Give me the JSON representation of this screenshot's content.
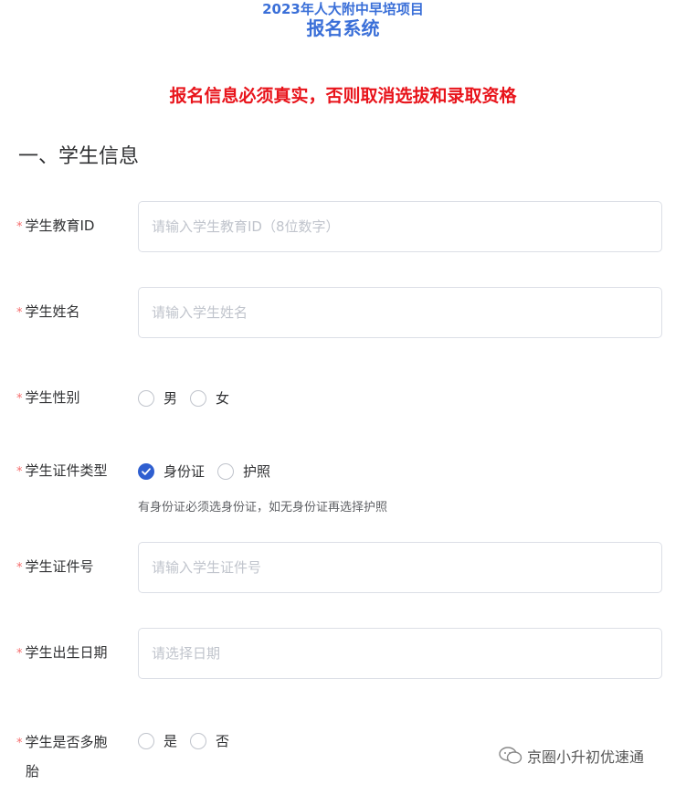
{
  "header": {
    "line1": "2023年人大附中早培项目",
    "line2": "报名系统"
  },
  "warning": "报名信息必须真实，否则取消选拔和录取资格",
  "section": {
    "title": "一、学生信息"
  },
  "fields": {
    "edu_id": {
      "label": "学生教育ID",
      "placeholder": "请输入学生教育ID（8位数字）"
    },
    "name": {
      "label": "学生姓名",
      "placeholder": "请输入学生姓名"
    },
    "gender": {
      "label": "学生性别",
      "options": [
        "男",
        "女"
      ]
    },
    "id_type": {
      "label": "学生证件类型",
      "options": [
        "身份证",
        "护照"
      ],
      "selected": "身份证",
      "hint": "有身份证必须选身份证，如无身份证再选择护照"
    },
    "id_number": {
      "label": "学生证件号",
      "placeholder": "请输入学生证件号"
    },
    "birth_date": {
      "label": "学生出生日期",
      "placeholder": "请选择日期"
    },
    "multiple_birth": {
      "label_line1": "学生是否多胞",
      "label_line2": "胎",
      "options": [
        "是",
        "否"
      ]
    }
  },
  "watermark": "京圈小升初优速通",
  "required_mark": "*",
  "colors": {
    "title_blue": "#3a6fd8",
    "warning_red": "#e8141b",
    "radio_checked": "#2f5fd0",
    "required_star": "#f56c6c"
  }
}
